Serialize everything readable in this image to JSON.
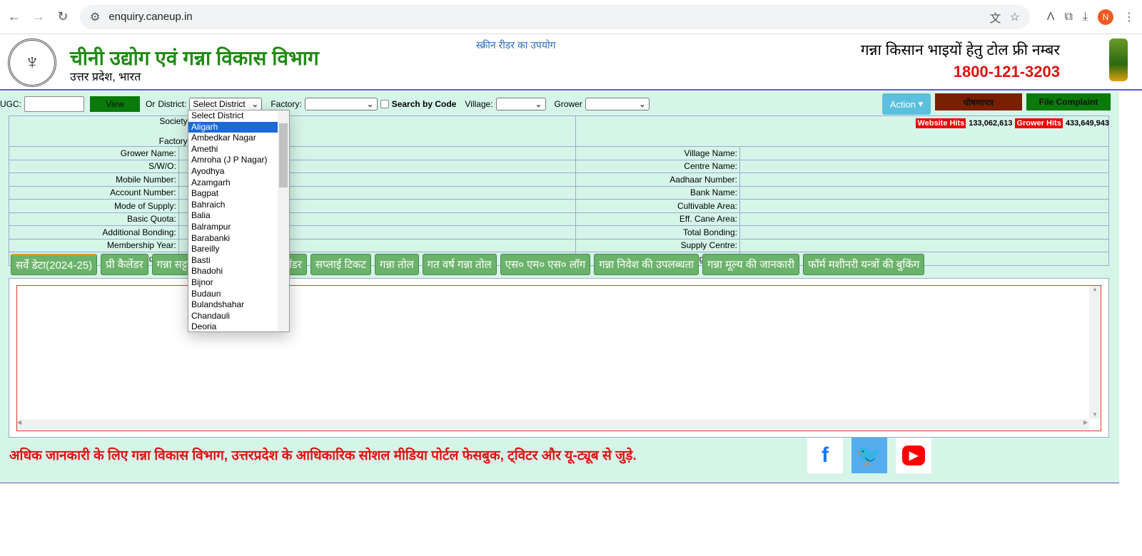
{
  "browser": {
    "url": "enquiry.caneup.in",
    "avatar": "N"
  },
  "header": {
    "title": "चीनी उद्योग एवं गन्ना विकास विभाग",
    "subtitle": "उत्तर प्रदेश, भारत",
    "screen_reader": "स्क्रीन रीडर का उपयोग",
    "tollfree_label": "गन्ना किसान भाइयों हेतु टोल फ्री नम्बर",
    "tollfree_number": "1800-121-3203"
  },
  "toolbar": {
    "ugc_label": "UGC:",
    "view": "View",
    "or": "Or",
    "district_label": "District:",
    "district_value": "Select District",
    "factory_label": "Factory:",
    "search_by_code": "Search by Code",
    "village_label": "Village:",
    "grower_label": "Grower",
    "action": "Action",
    "ghoshnapatra": "घोषणापत्र",
    "file_complaint": "File Complaint"
  },
  "hits": {
    "website_label": "Website Hits",
    "website_value": "133,062,613",
    "grower_label": "Grower Hits",
    "grower_value": "433,649,943"
  },
  "info": {
    "society": "Society:",
    "factory": "Factory:",
    "rows": [
      [
        "Grower Name:",
        "Village Name:"
      ],
      [
        "S/W/O:",
        "Centre Name:"
      ],
      [
        "Mobile Number:",
        "Aadhaar Number:"
      ],
      [
        "Account Number:",
        "Bank Name:"
      ],
      [
        "Mode of Supply:",
        "Cultivable Area:"
      ],
      [
        "Basic Quota:",
        "Eff. Cane Area:"
      ],
      [
        "Additional Bonding:",
        "Total Bonding:"
      ],
      [
        "Membership Year:",
        "Supply Centre:"
      ],
      [
        "Crop Yield/Hect:",
        "Factory Avg. Supply:"
      ]
    ]
  },
  "tabs": [
    "सर्वे डेटा(2024-25)",
    "प्री कैलेंडर",
    "गन्ना सट्टा कैलेंडर",
    "स्टैंडिंग केन कैलेंडर",
    "सप्लाई टिकट",
    "गन्ना तोल",
    "गत वर्ष गन्ना तोल",
    "एस० एम० एस० लॉग",
    "गन्ना निवेश की उपलब्धता",
    "गन्ना मूल्य की जानकारी",
    "फॉर्म मशीनरी यन्त्रों की बुकिंग"
  ],
  "footer": {
    "text": "अधिक जानकारी के लिए गन्ना विकास विभाग, उत्तरप्रदेश के आधिकारिक सोशल मीडिया पोर्टल फेसबुक, ट्विटर और यू-ट्यूब से जुड़े."
  },
  "district_options": [
    "Select District",
    "Aligarh",
    "Ambedkar Nagar",
    "Amethi",
    "Amroha (J P Nagar)",
    "Ayodhya",
    "Azamgarh",
    "Bagpat",
    "Bahraich",
    "Balia",
    "Balrampur",
    "Barabanki",
    "Bareilly",
    "Basti",
    "Bhadohi",
    "Bijnor",
    "Budaun",
    "Bulandshahar",
    "Chandauli",
    "Deoria"
  ],
  "district_highlighted": "Aligarh",
  "colors": {
    "green": "#1f8a12",
    "red": "#e01010",
    "panel": "#d6f5e9",
    "tab": "#6bb36b"
  }
}
